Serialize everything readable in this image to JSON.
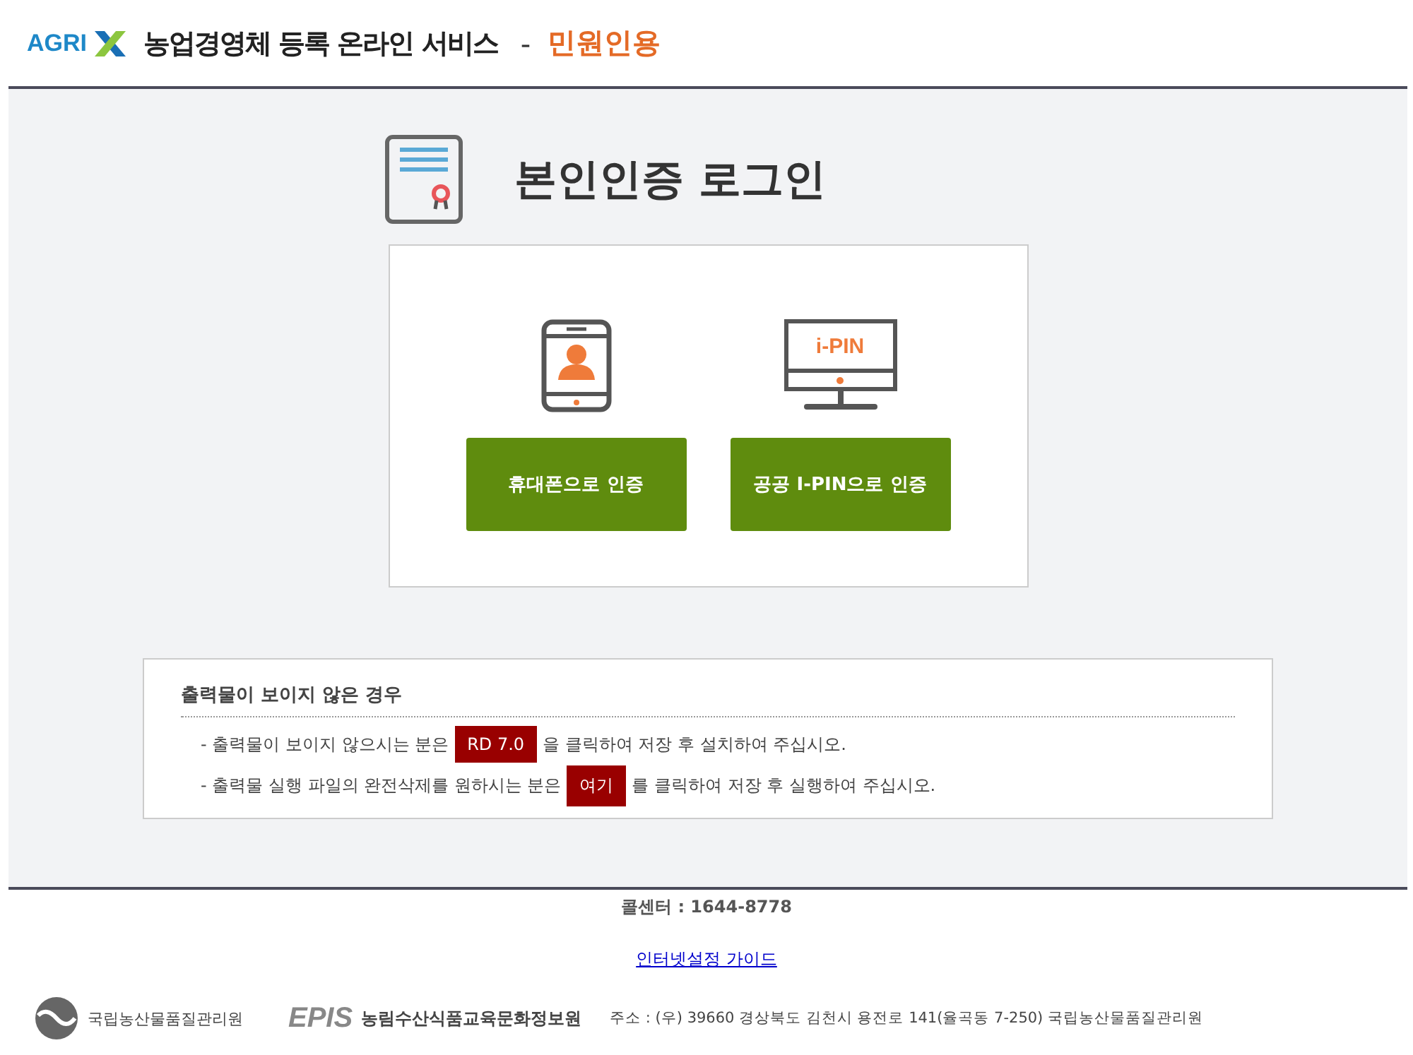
{
  "header": {
    "logo_text": "AGRI",
    "title": "농업경영체 등록 온라인 서비스",
    "separator": "-",
    "subtitle": "민원인용"
  },
  "login": {
    "title": "본인인증 로그인",
    "options": [
      {
        "kind": "phone",
        "button": "휴대폰으로 인증"
      },
      {
        "kind": "ipin",
        "icon_text": "i-PIN",
        "button": "공공 I-PIN으로 인증"
      }
    ]
  },
  "notice": {
    "title": "출력물이 보이지 않은 경우",
    "lines": [
      {
        "before": "- 출력물이 보이지 않으시는 분은",
        "button": "RD 7.0",
        "after": "을 클릭하여 저장 후 설치하여 주십시오."
      },
      {
        "before": "- 출력물 실행 파일의 완전삭제를 원하시는 분은",
        "button": "여기",
        "after": "를 클릭하여 저장 후 실행하여 주십시오."
      }
    ]
  },
  "footer": {
    "call_center": "콜센터 : 1644-8778",
    "guide_link": "인터넷설정 가이드",
    "org1": "국립농산물품질관리원",
    "org2_logo": "EPIS",
    "org2": "농림수산식품교육문화정보원",
    "address": "주소 : (우) 39660 경상북도 김천시 용전로 141(율곡동 7-250) 국립농산물품질관리원"
  }
}
